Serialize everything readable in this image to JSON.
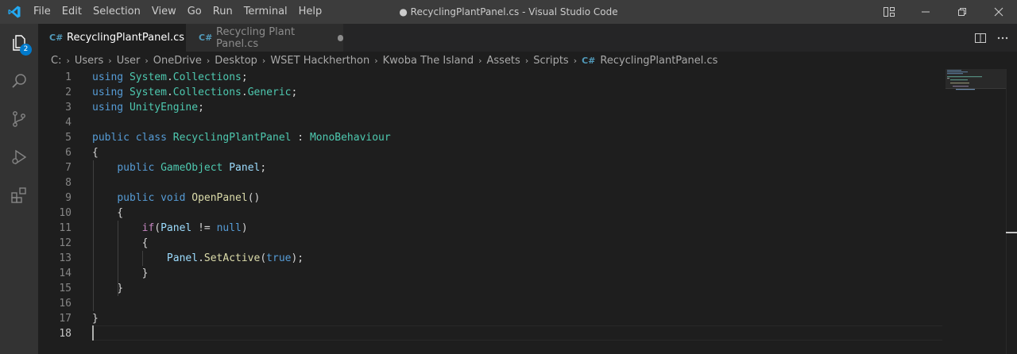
{
  "titlebar": {
    "menu": [
      "File",
      "Edit",
      "Selection",
      "View",
      "Go",
      "Run",
      "Terminal",
      "Help"
    ],
    "window_title": "● RecyclingPlantPanel.cs - Visual Studio Code"
  },
  "activitybar": {
    "items": [
      {
        "icon": "explorer-icon",
        "badge": "2"
      },
      {
        "icon": "search-icon"
      },
      {
        "icon": "source-control-icon"
      },
      {
        "icon": "run-debug-icon"
      },
      {
        "icon": "extensions-icon"
      }
    ]
  },
  "tabs": [
    {
      "label": "RecyclingPlantPanel.cs",
      "active": true,
      "modified": true
    },
    {
      "label": "Recycling Plant Panel.cs",
      "active": false,
      "modified": true
    }
  ],
  "breadcrumb": {
    "segments": [
      "C:",
      "Users",
      "User",
      "OneDrive",
      "Desktop",
      "WSET Hackherthon",
      "Kwoba The Island",
      "Assets",
      "Scripts"
    ],
    "file": "RecyclingPlantPanel.cs"
  },
  "editor": {
    "current_line": 18,
    "line_numbers": [
      "1",
      "2",
      "3",
      "4",
      "5",
      "6",
      "7",
      "8",
      "9",
      "10",
      "11",
      "12",
      "13",
      "14",
      "15",
      "16",
      "17",
      "18"
    ],
    "lines": [
      [
        {
          "t": "kw",
          "v": "using"
        },
        {
          "t": "plain",
          "v": " "
        },
        {
          "t": "ns",
          "v": "System"
        },
        {
          "t": "plain",
          "v": "."
        },
        {
          "t": "ns",
          "v": "Collections"
        },
        {
          "t": "plain",
          "v": ";"
        }
      ],
      [
        {
          "t": "kw",
          "v": "using"
        },
        {
          "t": "plain",
          "v": " "
        },
        {
          "t": "ns",
          "v": "System"
        },
        {
          "t": "plain",
          "v": "."
        },
        {
          "t": "ns",
          "v": "Collections"
        },
        {
          "t": "plain",
          "v": "."
        },
        {
          "t": "ns",
          "v": "Generic"
        },
        {
          "t": "plain",
          "v": ";"
        }
      ],
      [
        {
          "t": "kw",
          "v": "using"
        },
        {
          "t": "plain",
          "v": " "
        },
        {
          "t": "ns",
          "v": "UnityEngine"
        },
        {
          "t": "plain",
          "v": ";"
        }
      ],
      [],
      [
        {
          "t": "kw",
          "v": "public"
        },
        {
          "t": "plain",
          "v": " "
        },
        {
          "t": "kw",
          "v": "class"
        },
        {
          "t": "plain",
          "v": " "
        },
        {
          "t": "type",
          "v": "RecyclingPlantPanel"
        },
        {
          "t": "plain",
          "v": " : "
        },
        {
          "t": "type",
          "v": "MonoBehaviour"
        }
      ],
      [
        {
          "t": "plain",
          "v": "{"
        }
      ],
      [
        {
          "t": "plain",
          "v": "    "
        },
        {
          "t": "kw",
          "v": "public"
        },
        {
          "t": "plain",
          "v": " "
        },
        {
          "t": "type",
          "v": "GameObject"
        },
        {
          "t": "plain",
          "v": " "
        },
        {
          "t": "var",
          "v": "Panel"
        },
        {
          "t": "plain",
          "v": ";"
        }
      ],
      [],
      [
        {
          "t": "plain",
          "v": "    "
        },
        {
          "t": "kw",
          "v": "public"
        },
        {
          "t": "plain",
          "v": " "
        },
        {
          "t": "kw",
          "v": "void"
        },
        {
          "t": "plain",
          "v": " "
        },
        {
          "t": "fn",
          "v": "OpenPanel"
        },
        {
          "t": "plain",
          "v": "()"
        }
      ],
      [
        {
          "t": "plain",
          "v": "    {"
        }
      ],
      [
        {
          "t": "plain",
          "v": "        "
        },
        {
          "t": "ctl",
          "v": "if"
        },
        {
          "t": "plain",
          "v": "("
        },
        {
          "t": "var",
          "v": "Panel"
        },
        {
          "t": "plain",
          "v": " != "
        },
        {
          "t": "kw",
          "v": "null"
        },
        {
          "t": "plain",
          "v": ")"
        }
      ],
      [
        {
          "t": "plain",
          "v": "        {"
        }
      ],
      [
        {
          "t": "plain",
          "v": "            "
        },
        {
          "t": "var",
          "v": "Panel"
        },
        {
          "t": "plain",
          "v": "."
        },
        {
          "t": "fn",
          "v": "SetActive"
        },
        {
          "t": "plain",
          "v": "("
        },
        {
          "t": "kw",
          "v": "true"
        },
        {
          "t": "plain",
          "v": ");"
        }
      ],
      [
        {
          "t": "plain",
          "v": "        }"
        }
      ],
      [
        {
          "t": "plain",
          "v": "    }"
        }
      ],
      [],
      [
        {
          "t": "plain",
          "v": "}"
        }
      ],
      []
    ]
  },
  "colors": {
    "accent": "#007acc",
    "keyword": "#569cd6",
    "type": "#4ec9b0",
    "function": "#dcdcaa",
    "variable": "#9cdcfe",
    "control": "#c586c0"
  }
}
